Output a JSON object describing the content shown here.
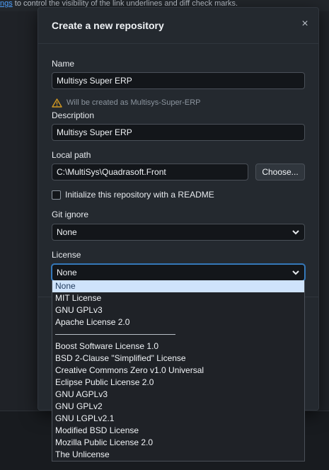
{
  "background": {
    "top_link": "ngs",
    "top_text": " to control the visibility of the link underlines and diff check marks."
  },
  "dialog": {
    "title": "Create a new repository",
    "close_glyph": "×",
    "name": {
      "label": "Name",
      "value": "Multisys Super ERP"
    },
    "warning": "Will be created as Multisys-Super-ERP",
    "description": {
      "label": "Description",
      "value": "Multisys Super ERP"
    },
    "local_path": {
      "label": "Local path",
      "value": "C:\\MultiSys\\Quadrasoft.Front",
      "choose_label": "Choose..."
    },
    "readme": {
      "label": "Initialize this repository with a README",
      "checked": false
    },
    "git_ignore": {
      "label": "Git ignore",
      "value": "None"
    },
    "license": {
      "label": "License",
      "value": "None",
      "options": [
        "None",
        "MIT License",
        "GNU GPLv3",
        "Apache License 2.0",
        "———",
        "Boost Software License 1.0",
        "BSD 2-Clause \"Simplified\" License",
        "Creative Commons Zero v1.0 Universal",
        "Eclipse Public License 2.0",
        "GNU AGPLv3",
        "GNU GPLv2",
        "GNU LGPLv2.1",
        "Modified BSD License",
        "Mozilla Public License 2.0",
        "The Unlicense"
      ]
    }
  },
  "colors": {
    "accent": "#3b82c4",
    "selected_option_bg": "#cfe3fb",
    "warning": "#d29922"
  },
  "icons": {
    "warning": "warning-triangle-icon",
    "close": "close-icon",
    "chevron": "chevron-down-icon"
  }
}
